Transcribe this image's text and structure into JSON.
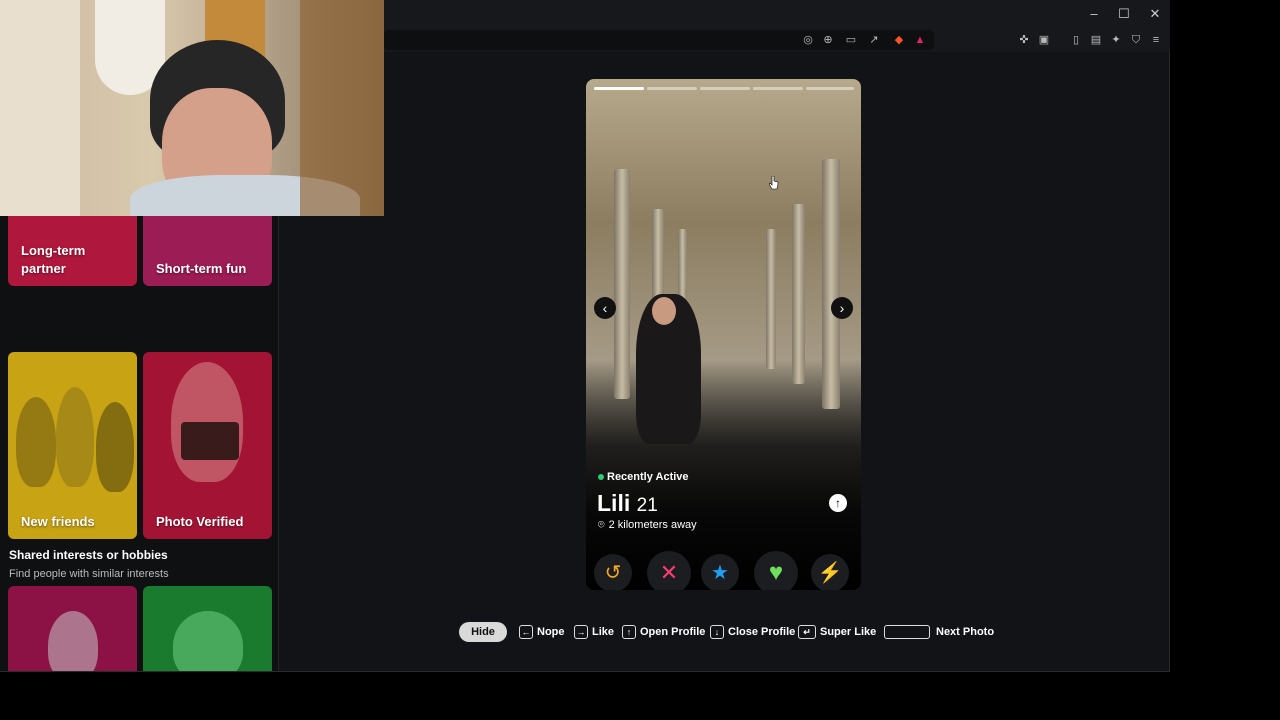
{
  "window": {
    "minimize_label": "–",
    "maximize_label": "☐",
    "close_label": "✕"
  },
  "toolbar": {
    "icons": [
      "location-icon",
      "zoom-icon",
      "cast-icon",
      "share-icon",
      "brave-shield-icon",
      "rewards-icon",
      "extensions-icon",
      "screenshot-icon",
      "sidebar-icon",
      "wallet-icon",
      "leo-icon",
      "vpn-icon",
      "menu-icon"
    ]
  },
  "sidebar": {
    "tiles": [
      {
        "label": "Long-term partner",
        "color": "#b0173d"
      },
      {
        "label": "Short-term fun",
        "color": "#9c1c55"
      },
      {
        "label": "New friends",
        "color": "#c8a313"
      },
      {
        "label": "Photo Verified",
        "color": "#a31434"
      }
    ],
    "section_title": "Shared interests or hobbies",
    "section_subtitle": "Find people with similar interests",
    "bottom_tiles": [
      {
        "color": "#8c1145"
      },
      {
        "color": "#1a7a2d"
      }
    ]
  },
  "profile": {
    "status": "Recently Active",
    "status_color": "#2ecc71",
    "name": "Lili",
    "age": "21",
    "distance": "2 kilometers away",
    "photo_count": 5,
    "photo_index": 1
  },
  "actions": [
    {
      "name": "rewind-button",
      "glyph": "↺",
      "color": "#f5a623"
    },
    {
      "name": "nope-button",
      "glyph": "✕",
      "color": "#fe3c72"
    },
    {
      "name": "super-like-button",
      "glyph": "★",
      "color": "#1ea1f2"
    },
    {
      "name": "like-button",
      "glyph": "♥",
      "color": "#6ee05c"
    },
    {
      "name": "boost-button",
      "glyph": "⚡",
      "color": "#a65cf5"
    }
  ],
  "shortcuts": {
    "hide": "Hide",
    "nope": "Nope",
    "like": "Like",
    "open_profile": "Open Profile",
    "close_profile": "Close Profile",
    "super_like": "Super Like",
    "next_photo": "Next Photo"
  }
}
